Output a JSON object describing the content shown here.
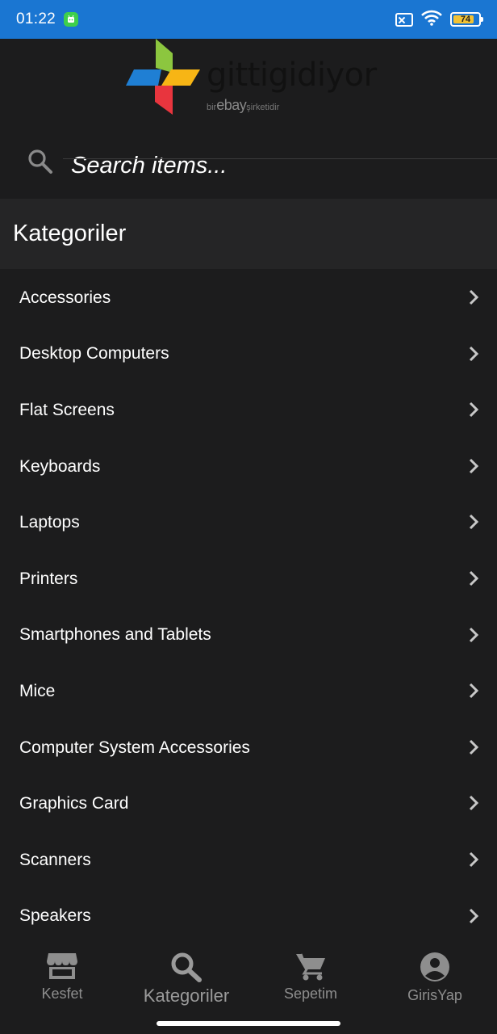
{
  "status_bar": {
    "time": "01:22",
    "battery_level": "74",
    "icons": [
      "app-notification-icon",
      "sim-off-icon",
      "wifi-icon",
      "battery-icon"
    ]
  },
  "header": {
    "logo_text": "gittigidiyor",
    "logo_sub_prefix": "bir",
    "logo_sub_brand": "ebay",
    "logo_sub_suffix": "şirketidir"
  },
  "search": {
    "placeholder": "Search items..."
  },
  "section": {
    "title": "Kategoriler"
  },
  "categories": [
    {
      "label": "Accessories"
    },
    {
      "label": "Desktop Computers"
    },
    {
      "label": "Flat Screens"
    },
    {
      "label": "Keyboards"
    },
    {
      "label": "Laptops"
    },
    {
      "label": "Printers"
    },
    {
      "label": "Smartphones and Tablets"
    },
    {
      "label": "Mice"
    },
    {
      "label": "Computer System Accessories"
    },
    {
      "label": "Graphics Card"
    },
    {
      "label": "Scanners"
    },
    {
      "label": "Speakers"
    }
  ],
  "bottom_nav": {
    "items": [
      {
        "label": "Kesfet",
        "icon": "store-icon",
        "active": false
      },
      {
        "label": "Kategoriler",
        "icon": "search-icon",
        "active": true
      },
      {
        "label": "Sepetim",
        "icon": "cart-icon",
        "active": false
      },
      {
        "label": "GirisYap",
        "icon": "account-icon",
        "active": false
      }
    ]
  },
  "colors": {
    "status_bar": "#1a76d2",
    "background": "#1c1c1d",
    "section_header": "#252526",
    "text": "#ffffff",
    "nav_inactive": "#8e8e8e"
  }
}
